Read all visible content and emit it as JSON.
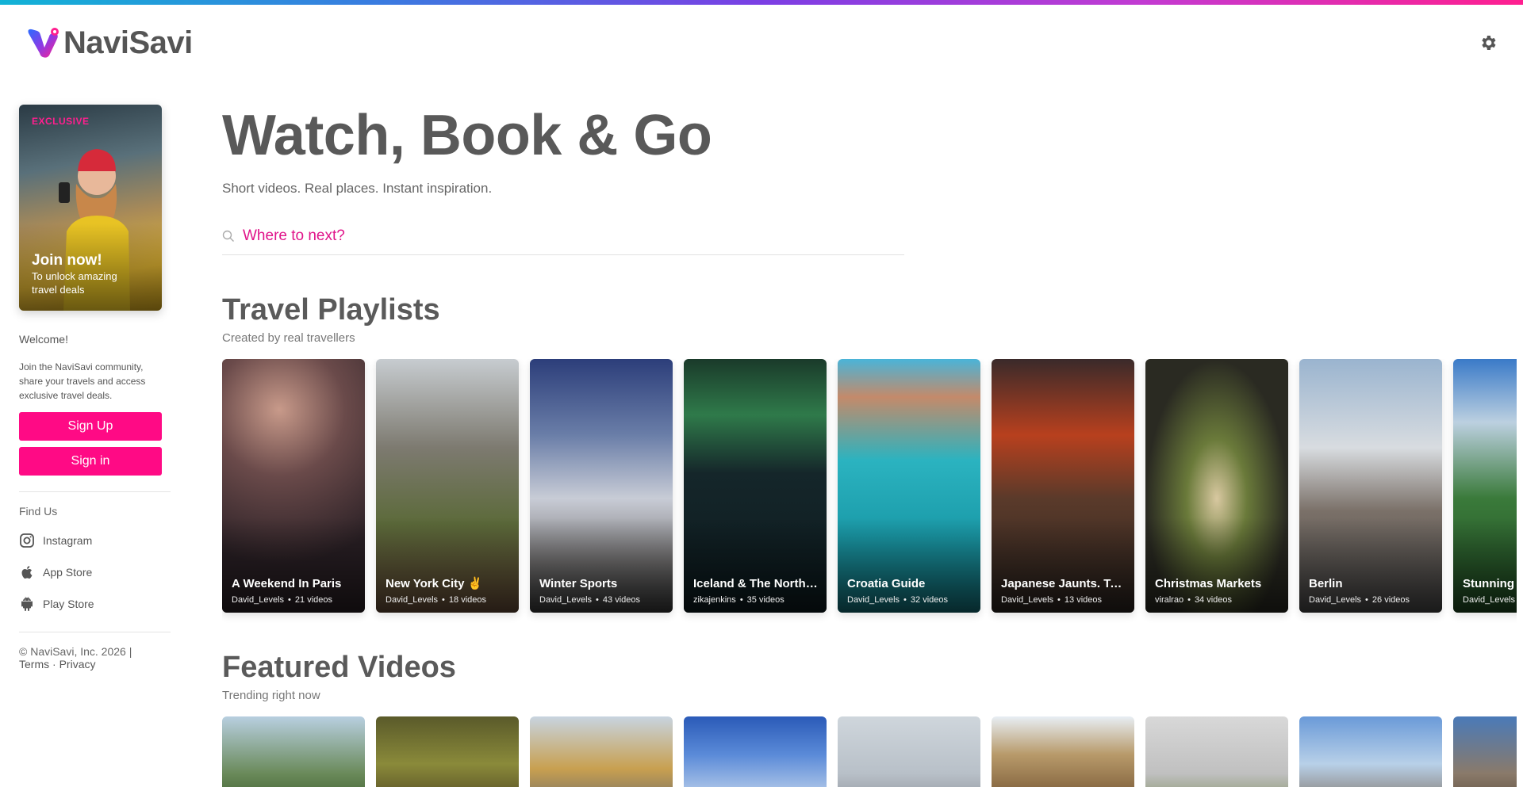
{
  "brand": {
    "name": "NaviSavi"
  },
  "header": {
    "settings_icon": "gear-icon"
  },
  "sidebar": {
    "promo": {
      "tag": "EXCLUSIVE",
      "title": "Join now!",
      "subtitle": "To unlock amazing travel deals"
    },
    "welcome": "Welcome!",
    "description": "Join the NaviSavi community, share your travels and access exclusive travel deals.",
    "signup_label": "Sign Up",
    "signin_label": "Sign in",
    "find_us": "Find Us",
    "social": [
      {
        "label": "Instagram",
        "icon": "instagram-icon"
      },
      {
        "label": "App Store",
        "icon": "apple-icon"
      },
      {
        "label": "Play Store",
        "icon": "android-icon"
      }
    ],
    "copyright": "© NaviSavi, Inc. 2026 |",
    "terms": "Terms",
    "privacy": "Privacy"
  },
  "hero": {
    "title": "Watch, Book & Go",
    "subtitle": "Short videos. Real places. Instant inspiration.",
    "search_placeholder": "Where to next?"
  },
  "playlists": {
    "title": "Travel Playlists",
    "subtitle": "Created by real travellers",
    "items": [
      {
        "title": "A Weekend In Paris",
        "author": "David_Levels",
        "count": "21 videos"
      },
      {
        "title": "New York City ✌️",
        "author": "David_Levels",
        "count": "18 videos"
      },
      {
        "title": "Winter Sports",
        "author": "David_Levels",
        "count": "43 videos"
      },
      {
        "title": "Iceland & The Northern Lights",
        "author": "zikajenkins",
        "count": "35 videos"
      },
      {
        "title": "Croatia Guide",
        "author": "David_Levels",
        "count": "32 videos"
      },
      {
        "title": "Japanese Jaunts. Tokyo",
        "author": "David_Levels",
        "count": "13 videos"
      },
      {
        "title": "Christmas Markets",
        "author": "viralrao",
        "count": "34 videos"
      },
      {
        "title": "Berlin",
        "author": "David_Levels",
        "count": "26 videos"
      },
      {
        "title": "Stunning Switzerland",
        "author": "David_Levels",
        "count": ""
      }
    ]
  },
  "featured": {
    "title": "Featured Videos",
    "subtitle": "Trending right now"
  },
  "colors": {
    "accent": "#ff0a85",
    "search_text": "#e0148a"
  }
}
